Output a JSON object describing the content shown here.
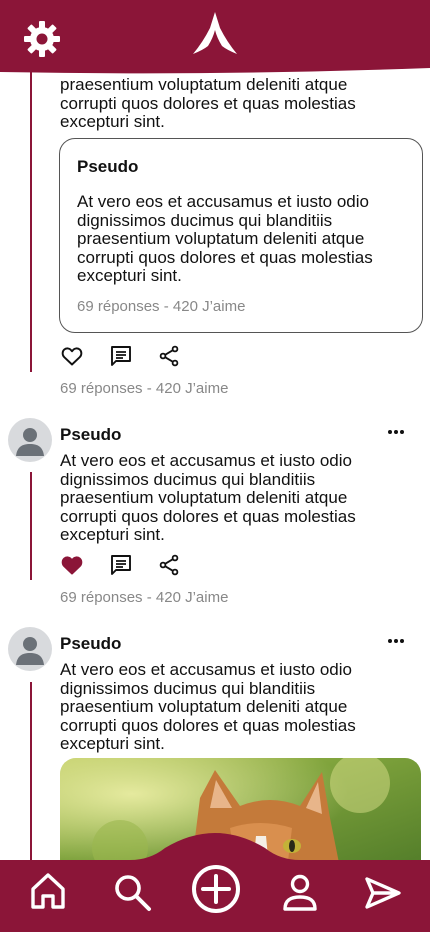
{
  "app": {
    "accent_color": "#8b1538",
    "logo": "peak-logo-icon",
    "settings_icon": "gear-icon"
  },
  "top_post": {
    "text_tail": "praesentium voluptatum deleniti atque corrupti quos dolores et quas molestias excepturi sint.",
    "quote": {
      "name": "Pseudo",
      "text": "At vero eos et accusamus et iusto odio dignissimos ducimus qui blanditiis praesentium voluptatum deleniti atque corrupti quos dolores et quas molestias excepturi sint.",
      "stats": "69 réponses - 420 J’aime"
    },
    "liked": false,
    "stats": "69 réponses - 420 J’aime"
  },
  "post_2": {
    "name": "Pseudo",
    "text": "At vero eos et accusamus et iusto odio dignissimos ducimus qui blanditiis praesentium voluptatum deleniti atque corrupti quos dolores et quas molestias excepturi sint.",
    "liked": true,
    "stats": "69 réponses - 420 J’aime"
  },
  "post_3": {
    "name": "Pseudo",
    "text": "At vero eos et accusamus et iusto odio dignissimos ducimus qui blanditiis praesentium voluptatum deleniti atque corrupti quos dolores et quas molestias excepturi sint.",
    "image": "cat-photo"
  },
  "bottom_nav": [
    "home-icon",
    "search-icon",
    "add-post-icon",
    "profile-icon",
    "send-icon"
  ]
}
